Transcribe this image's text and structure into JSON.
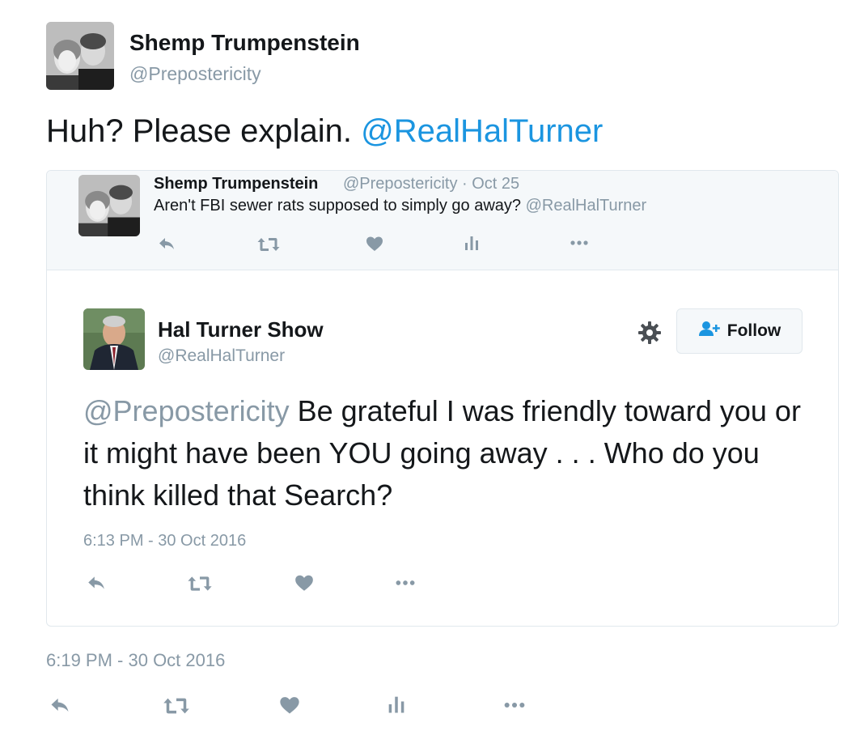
{
  "main_tweet": {
    "author_name": "Shemp Trumpenstein",
    "author_handle": "@Prepostericity",
    "text_plain": "Huh? Please explain. ",
    "text_mention": "@RealHalTurner",
    "timestamp": "6:19 PM - 30 Oct 2016"
  },
  "reply_context": {
    "author_name": "Shemp Trumpenstein",
    "meta": "@Prepostericity · Oct 25",
    "text_plain": "Aren't FBI sewer rats supposed to simply go away? ",
    "text_mention": "@RealHalTurner"
  },
  "embedded_tweet": {
    "author_name": "Hal Turner Show",
    "author_handle": "@RealHalTurner",
    "text_mention": "@Prepostericity",
    "text_plain": " Be grateful I was friendly toward you or it might have been YOU going away . . . Who do you think killed that Search?",
    "timestamp": "6:13 PM - 30 Oct 2016",
    "follow_label": "Follow"
  },
  "icons": {
    "reply": "reply-icon",
    "retweet": "retweet-icon",
    "like": "heart-icon",
    "analytics": "analytics-icon",
    "more": "more-icon",
    "settings": "gear-icon",
    "follow": "add-user-icon"
  },
  "colors": {
    "link": "#1b95e0",
    "muted": "#8899a6",
    "text": "#14171a",
    "border": "#e1e8ed",
    "strip": "#f5f8fa"
  }
}
